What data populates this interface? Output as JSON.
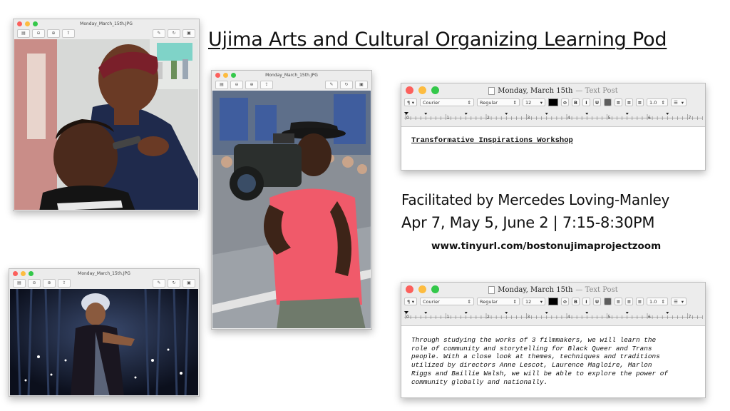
{
  "headline": "Ujima Arts and Cultural Organizing Learning Pod",
  "facilitator_line": "Facilitated by Mercedes Loving-Manley",
  "dates_line": "Apr 7, May 5, June 2 | 7:15-8:30PM",
  "url": "www.tinyurl.com/bostonujimaprojectzoom",
  "preview_windows": {
    "barbershop": {
      "title": "Monday_March_15th.JPG"
    },
    "filmmaker": {
      "title": "Monday_March_15th.JPG"
    },
    "performer": {
      "title": "Monday_March_15th.JPG"
    }
  },
  "textedit_top": {
    "title": "Monday, March 15th",
    "subtitle": "— Text Post",
    "paragraph_style": "¶",
    "font": "Courier",
    "weight": "Regular",
    "size": "12",
    "spacing": "1.0",
    "bold": "B",
    "italic": "I",
    "underline": "U",
    "heading": "Transformative Inspirations Workshop"
  },
  "textedit_bottom": {
    "title": "Monday, March 15th",
    "subtitle": "— Text Post",
    "paragraph_style": "¶",
    "font": "Courier",
    "weight": "Regular",
    "size": "12",
    "spacing": "1.0",
    "bold": "B",
    "italic": "I",
    "underline": "U",
    "body": "Through studying the works of 3 filmmakers, we will learn the\nrole of community and storytelling for Black Queer and Trans\npeople. With a close look at themes, techniques and traditions\nutilized by directors Anne Lescot, Laurence Magloire, Marlon\nRiggs and Baillie Walsh, we will be able to explore the power of\ncommunity globally and nationally."
  },
  "ruler_labels": [
    "0",
    "1",
    "2",
    "3",
    "4",
    "5",
    "6",
    "7"
  ],
  "colors": {
    "close": "#fc605c",
    "minimize": "#fdbc40",
    "zoom": "#34c84a"
  }
}
